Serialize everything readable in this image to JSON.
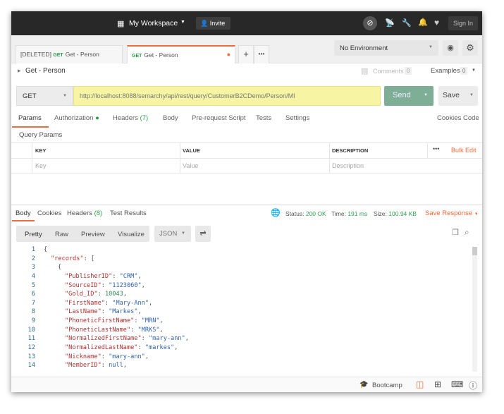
{
  "header": {
    "workspace": "My Workspace",
    "invite": "Invite",
    "sign_in": "Sign In"
  },
  "tabs": [
    {
      "prefix": "[DELETED]",
      "method": "GET",
      "label": "Get - Person"
    },
    {
      "method": "GET",
      "label": "Get - Person",
      "unsaved": true
    }
  ],
  "environment": {
    "selected": "No Environment"
  },
  "request": {
    "name": "Get - Person",
    "comments_label": "Comments",
    "comments_count": "0",
    "examples_label": "Examples",
    "examples_count": "0",
    "method": "GET",
    "url": "http://localhost:8088/semarchy/api/rest/query/CustomerB2CDemo/Person/MI",
    "send": "Send",
    "save": "Save"
  },
  "request_tabs": {
    "params": "Params",
    "authorization": "Authorization",
    "headers": "Headers",
    "headers_count": "(7)",
    "body": "Body",
    "prerequest": "Pre-request Script",
    "tests": "Tests",
    "settings": "Settings",
    "cookies": "Cookies",
    "code": "Code"
  },
  "query_params": {
    "title": "Query Params",
    "columns": {
      "key": "KEY",
      "value": "VALUE",
      "description": "DESCRIPTION"
    },
    "bulk_edit": "Bulk Edit",
    "placeholders": {
      "key": "Key",
      "value": "Value",
      "description": "Description"
    }
  },
  "response_tabs": {
    "body": "Body",
    "cookies": "Cookies",
    "headers": "Headers",
    "headers_count": "(8)",
    "test_results": "Test Results"
  },
  "response_meta": {
    "status_label": "Status:",
    "status": "200 OK",
    "time_label": "Time:",
    "time": "191 ms",
    "size_label": "Size:",
    "size": "100.94 KB",
    "save_response": "Save Response"
  },
  "view_modes": {
    "pretty": "Pretty",
    "raw": "Raw",
    "preview": "Preview",
    "visualize": "Visualize",
    "format": "JSON"
  },
  "code_lines": [
    {
      "n": "1",
      "indent": 0,
      "text": "{"
    },
    {
      "n": "2",
      "indent": 1,
      "key": "\"records\"",
      "text": ": ["
    },
    {
      "n": "3",
      "indent": 2,
      "text": "{"
    },
    {
      "n": "4",
      "indent": 3,
      "key": "\"PublisherID\"",
      "val": "\"CRM\"",
      "type": "s"
    },
    {
      "n": "5",
      "indent": 3,
      "key": "\"SourceID\"",
      "val": "\"1123060\"",
      "type": "s"
    },
    {
      "n": "6",
      "indent": 3,
      "key": "\"Gold_ID\"",
      "val": "10043",
      "type": "n"
    },
    {
      "n": "7",
      "indent": 3,
      "key": "\"FirstName\"",
      "val": "\"Mary-Ann\"",
      "type": "s"
    },
    {
      "n": "8",
      "indent": 3,
      "key": "\"LastName\"",
      "val": "\"Markes\"",
      "type": "s"
    },
    {
      "n": "9",
      "indent": 3,
      "key": "\"PhoneticFirstName\"",
      "val": "\"MRN\"",
      "type": "s"
    },
    {
      "n": "10",
      "indent": 3,
      "key": "\"PhoneticLastName\"",
      "val": "\"MRKS\"",
      "type": "s"
    },
    {
      "n": "11",
      "indent": 3,
      "key": "\"NormalizedFirstName\"",
      "val": "\"mary-ann\"",
      "type": "s"
    },
    {
      "n": "12",
      "indent": 3,
      "key": "\"NormalizedLastName\"",
      "val": "\"markes\"",
      "type": "s"
    },
    {
      "n": "13",
      "indent": 3,
      "key": "\"Nickname\"",
      "val": "\"mary-ann\"",
      "type": "s"
    },
    {
      "n": "14",
      "indent": 3,
      "key": "\"MemberID\"",
      "val": "null",
      "type": "s"
    }
  ],
  "footer": {
    "bootcamp": "Bootcamp"
  },
  "colors": {
    "accent": "#f26b3a",
    "send": "#7fae97",
    "url_bg": "#f7f4a4",
    "topbar": "#282828"
  }
}
